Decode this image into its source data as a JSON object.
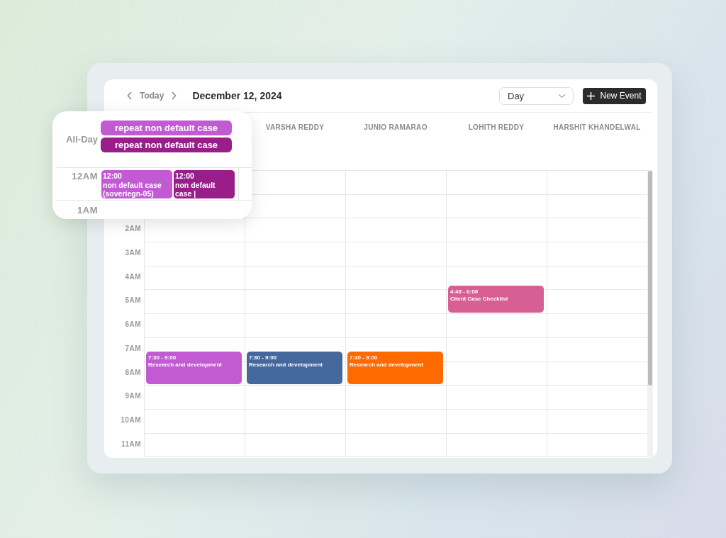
{
  "toolbar": {
    "today": "Today",
    "date": "December 12, 2024",
    "view": "Day",
    "new_event": "New Event"
  },
  "columns": [
    {
      "events": [
        {
          "time": "7:30 - 9:00",
          "title": "Research and development",
          "color": "#c25ad4"
        }
      ]
    },
    {
      "name": "VARSHA REDDY",
      "events": [
        {
          "time": "7:30 - 9:00",
          "title": "Research and development",
          "color": "#44679c"
        }
      ]
    },
    {
      "name": "JUNIO RAMARAO",
      "events": [
        {
          "time": "7:30 - 9:00",
          "title": "Research and development",
          "color": "#ff6a00"
        }
      ]
    },
    {
      "name": "LOHITH REDDY",
      "events": [
        {
          "time": "4:45 - 6:00",
          "title": "Client Case Checklist",
          "color": "#d85f94"
        }
      ]
    },
    {
      "name": "HARSHIT KHANDELWAL"
    }
  ],
  "hours": [
    "2AM",
    "3AM",
    "4AM",
    "5AM",
    "6AM",
    "7AM",
    "8AM",
    "9AM",
    "10AM",
    "11AM"
  ],
  "popup": {
    "all_day_label": "All-Day",
    "all_day_events": [
      {
        "title": "repeat non default case",
        "color": "#c25ad4"
      },
      {
        "title": "repeat non default case",
        "color": "#981f8a"
      }
    ],
    "hours": [
      "12AM",
      "1AM"
    ],
    "events": [
      {
        "time": "12:00",
        "title": "non default case (soveriegn-05)",
        "color": "#c25ad4"
      },
      {
        "time": "12:00",
        "title": "non default case |",
        "color": "#981f8a"
      }
    ]
  }
}
